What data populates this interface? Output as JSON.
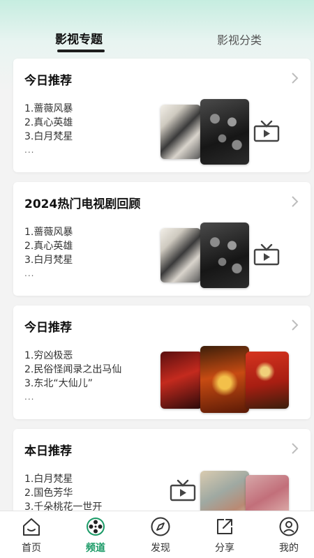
{
  "tabs": {
    "active_label": "影视专题",
    "inactive_label": "影视分类"
  },
  "cards": [
    {
      "title": "今日推荐",
      "items": [
        "1.蔷薇风暴",
        "2.真心英雄",
        "3.白月梵星"
      ],
      "more": "..."
    },
    {
      "title": "2024热门电视剧回顾",
      "items": [
        "1.蔷薇风暴",
        "2.真心英雄",
        "3.白月梵星"
      ],
      "more": "..."
    },
    {
      "title": "今日推荐",
      "items": [
        "1.穷凶极恶",
        "2.民俗怪闻录之出马仙",
        "3.东北“大仙儿”"
      ],
      "more": "..."
    },
    {
      "title": "本日推荐",
      "items": [
        "1.白月梵星",
        "2.国色芳华",
        "3.千朵桃花一世开"
      ],
      "more": ""
    }
  ],
  "bottom_nav": {
    "items": [
      {
        "label": "首页",
        "icon": "home-icon"
      },
      {
        "label": "频道",
        "icon": "film-reel-icon"
      },
      {
        "label": "发现",
        "icon": "compass-icon"
      },
      {
        "label": "分享",
        "icon": "share-icon"
      },
      {
        "label": "我的",
        "icon": "profile-icon"
      }
    ],
    "active_index": 1,
    "active_color": "#1a9a66"
  }
}
